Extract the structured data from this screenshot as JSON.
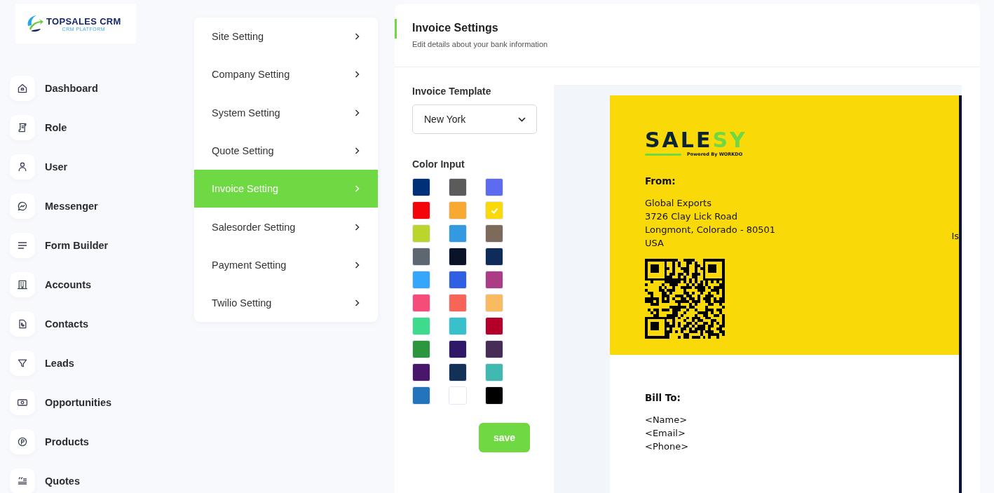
{
  "brand": {
    "name": "TOPSALES CRM",
    "tagline": "CRM PLATFORM"
  },
  "sidebar": {
    "items": [
      {
        "label": "Dashboard"
      },
      {
        "label": "Role"
      },
      {
        "label": "User"
      },
      {
        "label": "Messenger"
      },
      {
        "label": "Form Builder"
      },
      {
        "label": "Accounts"
      },
      {
        "label": "Contacts"
      },
      {
        "label": "Leads"
      },
      {
        "label": "Opportunities"
      },
      {
        "label": "Products"
      },
      {
        "label": "Quotes"
      }
    ]
  },
  "settings_menu": [
    {
      "label": "Site Setting",
      "selected": false
    },
    {
      "label": "Company Setting",
      "selected": false
    },
    {
      "label": "System Setting",
      "selected": false
    },
    {
      "label": "Quote Setting",
      "selected": false
    },
    {
      "label": "Invoice Setting",
      "selected": true
    },
    {
      "label": "Salesorder Setting",
      "selected": false
    },
    {
      "label": "Payment Setting",
      "selected": false
    },
    {
      "label": "Twilio Setting",
      "selected": false
    }
  ],
  "panel": {
    "title": "Invoice Settings",
    "subtitle": "Edit details about your bank information",
    "template_label": "Invoice Template",
    "template_value": "New York",
    "color_label": "Color Input",
    "colors": [
      {
        "color": "#003078",
        "selected": false
      },
      {
        "color": "#5b5b5b",
        "selected": false
      },
      {
        "color": "#5c6bf0",
        "selected": false
      },
      {
        "color": "#f4050b",
        "selected": false
      },
      {
        "color": "#f7a932",
        "selected": false
      },
      {
        "color": "#fad909",
        "selected": true
      },
      {
        "color": "#bbd52c",
        "selected": false
      },
      {
        "color": "#3399e0",
        "selected": false
      },
      {
        "color": "#7d6a5a",
        "selected": false
      },
      {
        "color": "#5e6670",
        "selected": false
      },
      {
        "color": "#0b1328",
        "selected": false
      },
      {
        "color": "#0f2c58",
        "selected": false
      },
      {
        "color": "#36a6fc",
        "selected": false
      },
      {
        "color": "#2f5fe3",
        "selected": false
      },
      {
        "color": "#ac3d85",
        "selected": false
      },
      {
        "color": "#f64c7a",
        "selected": false
      },
      {
        "color": "#f66556",
        "selected": false
      },
      {
        "color": "#f9bb60",
        "selected": false
      },
      {
        "color": "#3ddb8b",
        "selected": false
      },
      {
        "color": "#39c1cb",
        "selected": false
      },
      {
        "color": "#b40029",
        "selected": false
      },
      {
        "color": "#2c963e",
        "selected": false
      },
      {
        "color": "#2f1868",
        "selected": false
      },
      {
        "color": "#472c55",
        "selected": false
      },
      {
        "color": "#4a166c",
        "selected": false
      },
      {
        "color": "#123158",
        "selected": false
      },
      {
        "color": "#40b9b0",
        "selected": false
      },
      {
        "color": "#2474bb",
        "selected": false
      },
      {
        "color": "#ffffff",
        "selected": false
      },
      {
        "color": "#000000",
        "selected": false
      }
    ],
    "save_button": "save"
  },
  "invoice_preview": {
    "wordmark": [
      {
        "text": "SALE",
        "accent": false
      },
      {
        "text": "SY",
        "accent": true
      }
    ],
    "wordmark_tagline": "Powered By WORKDO",
    "from_label": "From:",
    "from_lines": [
      "Global Exports",
      "3726 Clay Lick Road",
      "Longmont, Colorado - 80501",
      "USA"
    ],
    "right_text": "Is",
    "bill_to_label": "Bill To:",
    "bill_to_lines": [
      "<Name>",
      "<Email>",
      "<Phone>"
    ]
  }
}
